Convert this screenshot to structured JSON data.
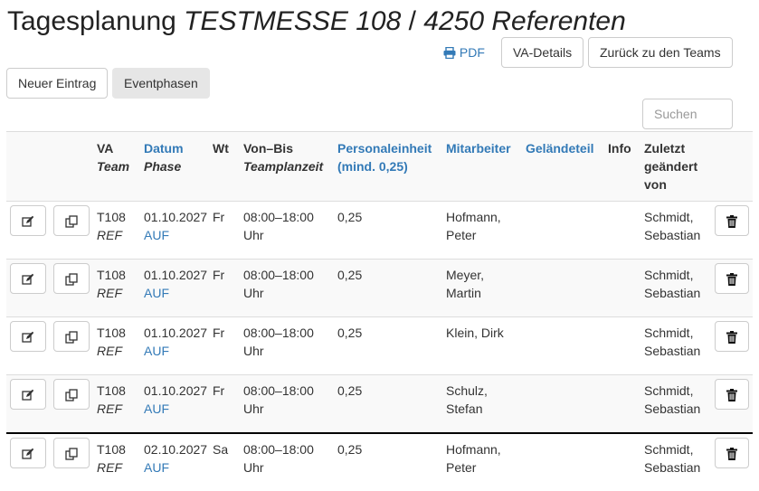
{
  "header": {
    "title_prefix": "Tagesplanung ",
    "title_event": "TESTMESSE 108",
    "title_sep": " / ",
    "title_group": "4250 Referenten"
  },
  "toolbar": {
    "pdf_label": "PDF",
    "details_label": "VA-Details",
    "back_label": "Zurück zu den Teams",
    "new_entry_label": "Neuer Eintrag",
    "phases_label": "Eventphasen"
  },
  "search": {
    "placeholder": "Suchen"
  },
  "table": {
    "headers": {
      "va": "VA",
      "team": "Team",
      "datum": "Datum",
      "phase": "Phase",
      "wt": "Wt",
      "vonbis": "Von–Bis",
      "teamplanzeit": "Teamplanzeit",
      "pe1": "Personaleinheit",
      "pe2": "(mind. 0,25)",
      "mitarbeiter": "Mitarbeiter",
      "gelaendeteil": "Geländeteil",
      "info": "Info",
      "z1": "Zuletzt",
      "z2": "geändert",
      "z3": "von"
    },
    "rows": [
      {
        "va": "T108",
        "team": "REF",
        "datum": "01.10.2027",
        "phase": "AUF",
        "wt": "Fr",
        "zeit1": "08:00–18:00",
        "zeit2": "Uhr",
        "pe": "0,25",
        "ma1": "Hofmann,",
        "ma2": "Peter",
        "gel": "",
        "info": "",
        "ge1": "Schmidt,",
        "ge2": "Sebastian"
      },
      {
        "va": "T108",
        "team": "REF",
        "datum": "01.10.2027",
        "phase": "AUF",
        "wt": "Fr",
        "zeit1": "08:00–18:00",
        "zeit2": "Uhr",
        "pe": "0,25",
        "ma1": "Meyer,",
        "ma2": "Martin",
        "gel": "",
        "info": "",
        "ge1": "Schmidt,",
        "ge2": "Sebastian"
      },
      {
        "va": "T108",
        "team": "REF",
        "datum": "01.10.2027",
        "phase": "AUF",
        "wt": "Fr",
        "zeit1": "08:00–18:00",
        "zeit2": "Uhr",
        "pe": "0,25",
        "ma1": "Klein, Dirk",
        "ma2": "",
        "gel": "",
        "info": "",
        "ge1": "Schmidt,",
        "ge2": "Sebastian"
      },
      {
        "va": "T108",
        "team": "REF",
        "datum": "01.10.2027",
        "phase": "AUF",
        "wt": "Fr",
        "zeit1": "08:00–18:00",
        "zeit2": "Uhr",
        "pe": "0,25",
        "ma1": "Schulz,",
        "ma2": "Stefan",
        "gel": "",
        "info": "",
        "ge1": "Schmidt,",
        "ge2": "Sebastian"
      },
      {
        "va": "T108",
        "team": "REF",
        "datum": "02.10.2027",
        "phase": "AUF",
        "wt": "Sa",
        "zeit1": "08:00–18:00",
        "zeit2": "Uhr",
        "pe": "0,25",
        "ma1": "Hofmann,",
        "ma2": "Peter",
        "gel": "",
        "info": "",
        "ge1": "Schmidt,",
        "ge2": "Sebastian"
      }
    ]
  },
  "colors": {
    "link": "#337ab7",
    "stripe": "#f9f9f9",
    "border": "#dddddd"
  },
  "icons": {
    "edit": "edit-icon",
    "copy": "copy-icon",
    "delete": "trash-icon",
    "pdf": "print-icon"
  }
}
